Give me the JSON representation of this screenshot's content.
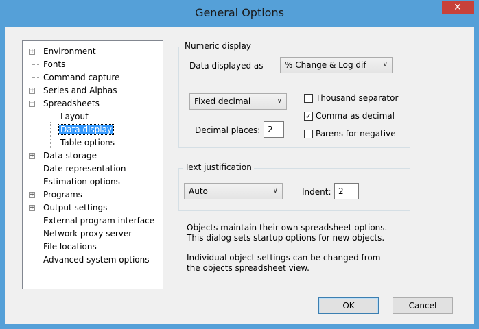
{
  "window": {
    "title": "General Options",
    "close_glyph": "✕"
  },
  "tree": {
    "items": [
      {
        "label": "Environment",
        "expander": "+"
      },
      {
        "label": "Fonts"
      },
      {
        "label": "Command capture"
      },
      {
        "label": "Series and Alphas",
        "expander": "+"
      },
      {
        "label": "Spreadsheets",
        "expander": "−"
      },
      {
        "label": "Layout"
      },
      {
        "label": "Data display",
        "selected": true
      },
      {
        "label": "Table options"
      },
      {
        "label": "Data storage",
        "expander": "+"
      },
      {
        "label": "Date representation"
      },
      {
        "label": "Estimation options"
      },
      {
        "label": "Programs",
        "expander": "+"
      },
      {
        "label": "Output settings",
        "expander": "+"
      },
      {
        "label": "External program interface"
      },
      {
        "label": "Network proxy server"
      },
      {
        "label": "File locations"
      },
      {
        "label": "Advanced system options"
      }
    ]
  },
  "numeric": {
    "legend": "Numeric display",
    "data_displayed_label": "Data displayed as",
    "data_displayed_value": "% Change & Log dif",
    "format_value": "Fixed decimal",
    "decimal_places_label": "Decimal places:",
    "decimal_places_value": "2",
    "thousand_label": "Thousand separator",
    "comma_label": "Comma as decimal",
    "parens_label": "Parens for negative",
    "thousand_checked": false,
    "comma_checked": true,
    "parens_checked": false
  },
  "text": {
    "legend": "Text justification",
    "justify_value": "Auto",
    "indent_label": "Indent:",
    "indent_value": "2"
  },
  "info": {
    "line1": "Objects maintain their own spreadsheet options.",
    "line2": "This dialog sets startup options for new objects.",
    "line3": "Individual object settings can be changed from",
    "line4": "the objects spreadsheet view."
  },
  "buttons": {
    "ok": "OK",
    "cancel": "Cancel"
  },
  "icons": {
    "chevron": "∨",
    "check": "✓"
  },
  "colors": {
    "titlebar": "#55a0d8",
    "close": "#c7413a",
    "selection": "#3399ff"
  }
}
